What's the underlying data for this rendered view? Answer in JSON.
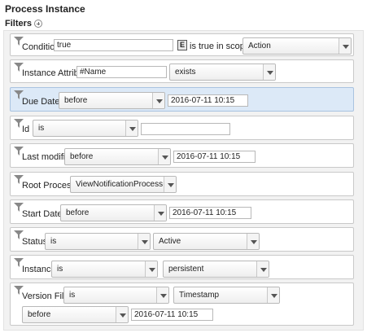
{
  "title": "Process Instance",
  "filters_label": "Filters",
  "rows": {
    "condition": {
      "label": "Condition",
      "value": "true",
      "e_button": "E",
      "scope_text": "is true in scope of",
      "scope": "Action"
    },
    "instance_attribute": {
      "label": "Instance Attribute",
      "value": "#Name",
      "operator": "exists"
    },
    "due_date": {
      "label": "Due Date is",
      "operator": "before",
      "value": "2016-07-11 10:15"
    },
    "id": {
      "label": "Id",
      "operator": "is",
      "value": ""
    },
    "last_modified": {
      "label": "Last modified",
      "operator": "before",
      "value": "2016-07-11 10:15"
    },
    "root_process": {
      "label": "Root Process is",
      "value": "ViewNotificationProcess"
    },
    "start_date": {
      "label": "Start Date is",
      "operator": "before",
      "value": "2016-07-11 10:15"
    },
    "status": {
      "label": "Status",
      "operator": "is",
      "value": "Active"
    },
    "instance": {
      "label": "Instance",
      "operator": "is",
      "value": "persistent"
    },
    "version_filter": {
      "label": "Version Filter",
      "operator": "is",
      "type": "Timestamp",
      "comparison": "before",
      "value": "2016-07-11 10:15"
    }
  }
}
